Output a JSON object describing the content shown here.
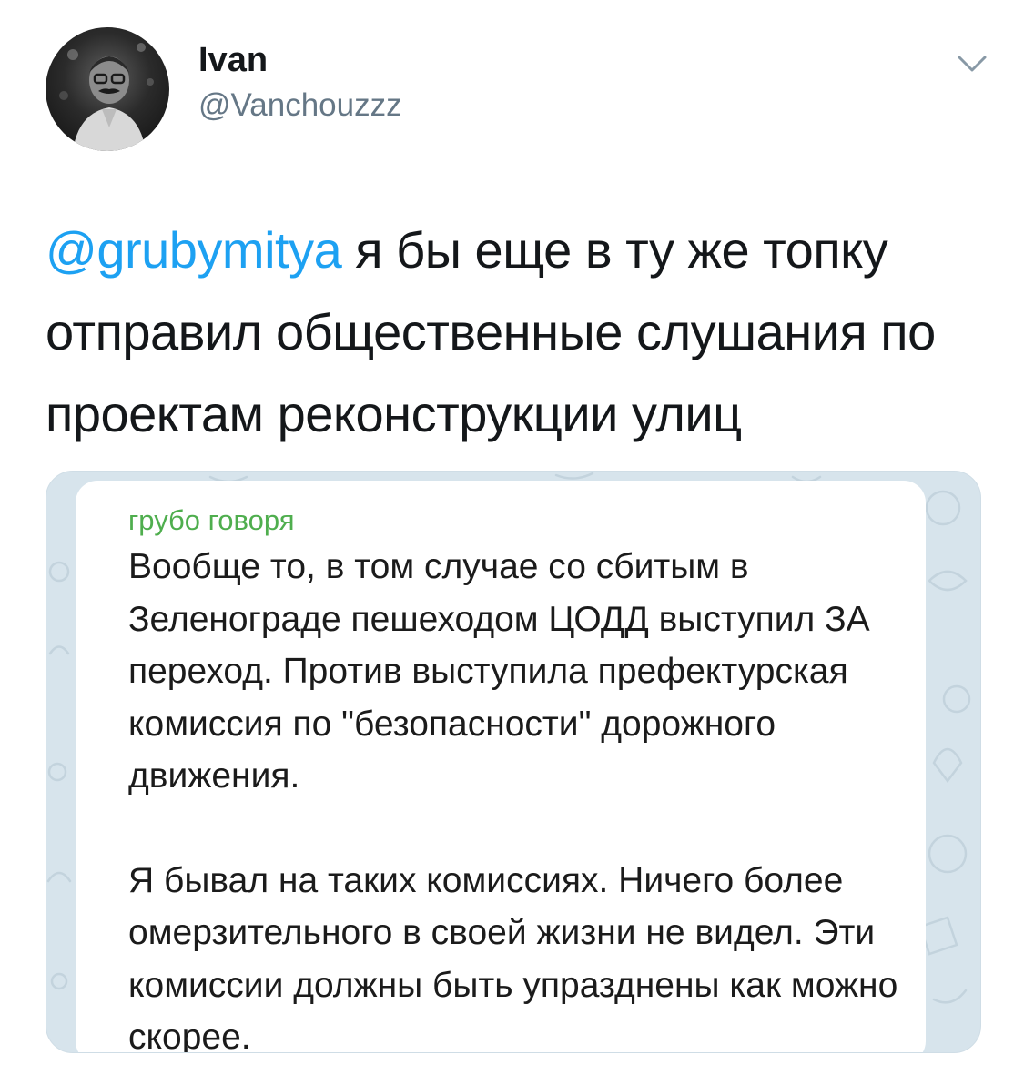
{
  "tweet": {
    "author": {
      "display_name": "Ivan",
      "username": "@Vanchouzzz"
    },
    "menu_icon": "chevron-down-icon",
    "mention": "@grubymitya",
    "text": " я бы еще в ту же топку отправил общественные слушания по проектам реконструкции улиц"
  },
  "attachment": {
    "sender": "грубо говоря",
    "paragraphs": [
      "Вообще то, в том случае со сбитым в Зеленограде пешеходом ЦОДД выступил ЗА переход. Против выступила префектурская комиссия по \"безопасности\" дорожного движения.",
      "Я бывал на таких комиссиях. Ничего более омерзительного в своей жизни не видел. Эти комиссии должны быть упразднены как можно скорее."
    ]
  },
  "colors": {
    "link": "#1da1f2",
    "secondary_text": "#657786",
    "sender_name": "#4fae4e",
    "chat_background": "#d7e4ec"
  }
}
